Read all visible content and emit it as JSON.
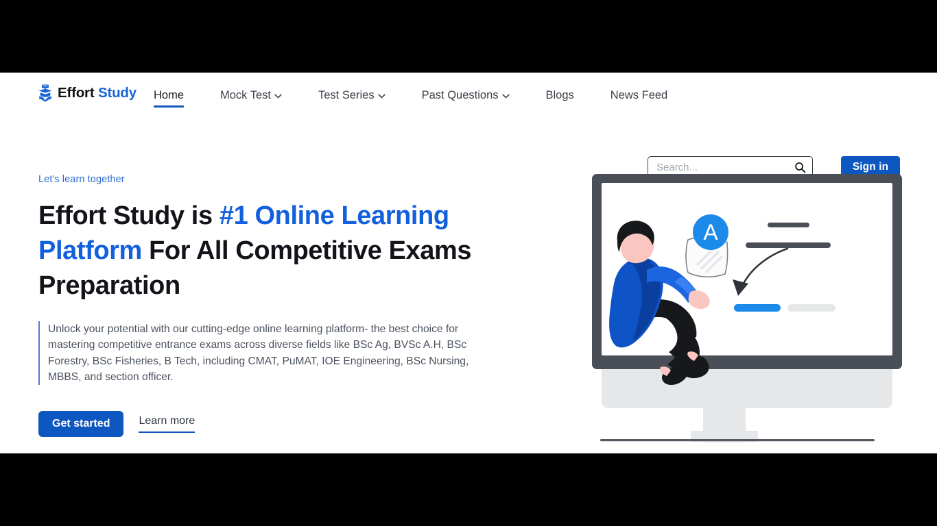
{
  "header": {
    "brand": {
      "icon": "graduation-book-icon",
      "text_primary": "Effort",
      "text_accent": "Study"
    },
    "nav": [
      {
        "label": "Home",
        "has_dropdown": false,
        "active": true
      },
      {
        "label": "Mock Test",
        "has_dropdown": true,
        "active": false
      },
      {
        "label": "Test Series",
        "has_dropdown": true,
        "active": false
      },
      {
        "label": "Past Questions",
        "has_dropdown": true,
        "active": false
      },
      {
        "label": "Blogs",
        "has_dropdown": false,
        "active": false
      },
      {
        "label": "News Feed",
        "has_dropdown": false,
        "active": false
      }
    ],
    "search": {
      "placeholder": "Search...",
      "value": "",
      "icon": "search-icon"
    },
    "signin_label": "Sign in"
  },
  "hero": {
    "eyebrow": "Let's learn together",
    "title_part1": "Effort Study is ",
    "title_highlight1": "#1 Online Learning Platform",
    "title_part2": " For All Competitive Exams Preparation",
    "description": "Unlock your potential with our cutting-edge online learning platform- the best choice for mastering competitive entrance exams across diverse fields like BSc Ag, BVSc A.H, BSc Forestry, BSc Fisheries, B Tech, including CMAT, PuMAT, IOE Engineering, BSc Nursing, MBBS, and section officer.",
    "primary_cta": "Get started",
    "secondary_cta": "Learn more",
    "illustration": {
      "name": "student-on-monitor-illustration",
      "grade_badge": "A"
    }
  },
  "colors": {
    "brand_blue": "#1565d8",
    "button_blue": "#0d57c1",
    "heading_blue": "#1260dd",
    "eyebrow_blue": "#2d6ad0",
    "text_dark": "#12141a",
    "text_body": "#4a525e",
    "monitor_frame": "#4a4f57",
    "monitor_body": "#e6e7e8",
    "accent_blue_bar": "#1c8ae8",
    "letterbox": "#000000"
  }
}
